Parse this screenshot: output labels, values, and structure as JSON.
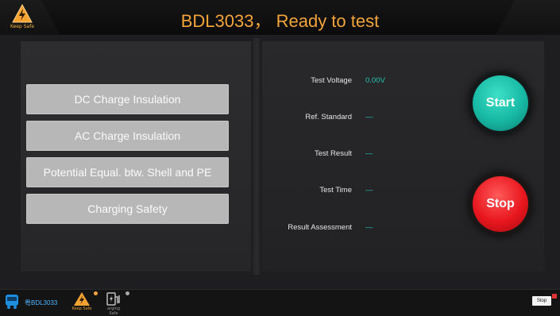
{
  "header": {
    "title": "BDL3033， Ready to test",
    "logo_caption": "Keep Safe"
  },
  "menu": {
    "items": [
      {
        "label": "DC Charge Insulation"
      },
      {
        "label": "AC Charge Insulation"
      },
      {
        "label": "Potential Equal. btw. Shell and PE"
      },
      {
        "label": "Charging Safety"
      }
    ]
  },
  "results": {
    "rows": [
      {
        "label": "Test Voltage",
        "value": "0.00V"
      },
      {
        "label": "Ref. Standard",
        "value": "—"
      },
      {
        "label": "Test Result",
        "value": "—"
      },
      {
        "label": "Test Time",
        "value": "—"
      },
      {
        "label": "Result Assessment",
        "value": "—"
      }
    ]
  },
  "controls": {
    "start_label": "Start",
    "stop_label": "Stop"
  },
  "taskbar": {
    "device_label": "粤BDL3033",
    "app1_label": "Keep Safe",
    "app2_label": "arging Safe",
    "stop_mini": "Stop"
  },
  "colors": {
    "accent_orange": "#f3a43b",
    "value_teal": "#27c4b0",
    "start": "#17b8a3",
    "stop": "#e8161e"
  }
}
